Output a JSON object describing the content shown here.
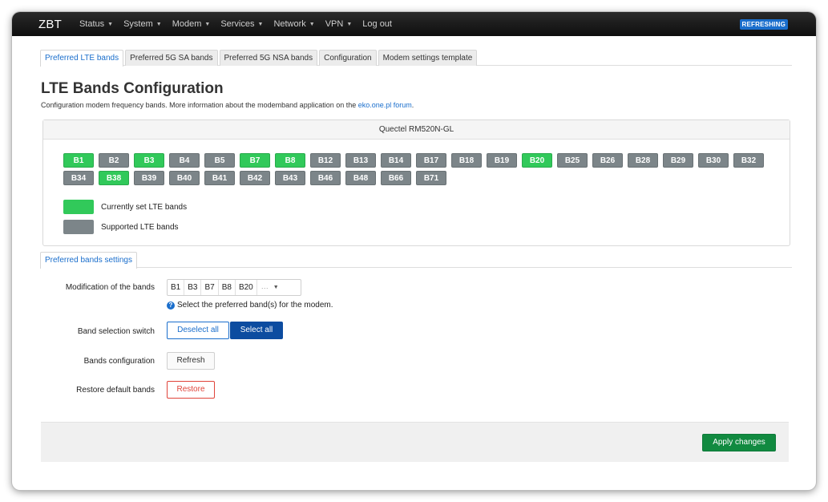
{
  "navbar": {
    "brand": "ZBT",
    "items": [
      {
        "label": "Status",
        "dropdown": true
      },
      {
        "label": "System",
        "dropdown": true
      },
      {
        "label": "Modem",
        "dropdown": true
      },
      {
        "label": "Services",
        "dropdown": true
      },
      {
        "label": "Network",
        "dropdown": true
      },
      {
        "label": "VPN",
        "dropdown": true
      },
      {
        "label": "Log out",
        "dropdown": false
      }
    ],
    "badge": "REFRESHING"
  },
  "tabs": [
    {
      "label": "Preferred LTE bands",
      "active": true
    },
    {
      "label": "Preferred 5G SA bands",
      "active": false
    },
    {
      "label": "Preferred 5G NSA bands",
      "active": false
    },
    {
      "label": "Configuration",
      "active": false
    },
    {
      "label": "Modem settings template",
      "active": false
    }
  ],
  "page": {
    "title": "LTE Bands Configuration",
    "description": "Configuration modem frequency bands. More information about the modemband application on the ",
    "link_text": "eko.one.pl forum",
    "description_end": "."
  },
  "bands_panel": {
    "modem": "Quectel RM520N-GL",
    "bands": [
      {
        "label": "B1",
        "set": true
      },
      {
        "label": "B2",
        "set": false
      },
      {
        "label": "B3",
        "set": true
      },
      {
        "label": "B4",
        "set": false
      },
      {
        "label": "B5",
        "set": false
      },
      {
        "label": "B7",
        "set": true
      },
      {
        "label": "B8",
        "set": true
      },
      {
        "label": "B12",
        "set": false
      },
      {
        "label": "B13",
        "set": false
      },
      {
        "label": "B14",
        "set": false
      },
      {
        "label": "B17",
        "set": false
      },
      {
        "label": "B18",
        "set": false
      },
      {
        "label": "B19",
        "set": false
      },
      {
        "label": "B20",
        "set": true
      },
      {
        "label": "B25",
        "set": false
      },
      {
        "label": "B26",
        "set": false
      },
      {
        "label": "B28",
        "set": false
      },
      {
        "label": "B29",
        "set": false
      },
      {
        "label": "B30",
        "set": false
      },
      {
        "label": "B32",
        "set": false
      },
      {
        "label": "B34",
        "set": false
      },
      {
        "label": "B38",
        "set": true
      },
      {
        "label": "B39",
        "set": false
      },
      {
        "label": "B40",
        "set": false
      },
      {
        "label": "B41",
        "set": false
      },
      {
        "label": "B42",
        "set": false
      },
      {
        "label": "B43",
        "set": false
      },
      {
        "label": "B46",
        "set": false
      },
      {
        "label": "B48",
        "set": false
      },
      {
        "label": "B66",
        "set": false
      },
      {
        "label": "B71",
        "set": false
      }
    ],
    "legend": {
      "current": "Currently set LTE bands",
      "supported": "Supported LTE bands",
      "current_color": "#31c95a",
      "supported_color": "#7c8589"
    }
  },
  "settings_tab": "Preferred bands settings",
  "settings": {
    "modification_label": "Modification of the bands",
    "selected_bands": [
      "B1",
      "B3",
      "B7",
      "B8",
      "B20"
    ],
    "more_indicator": "···",
    "help_text": "Select the preferred band(s) for the modem.",
    "switch_label": "Band selection switch",
    "deselect_all": "Deselect all",
    "select_all": "Select all",
    "config_label": "Bands configuration",
    "refresh": "Refresh",
    "restore_label": "Restore default bands",
    "restore": "Restore"
  },
  "footer": {
    "apply": "Apply changes"
  }
}
